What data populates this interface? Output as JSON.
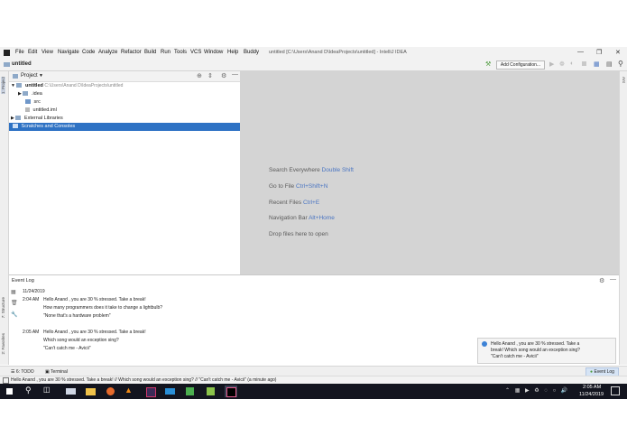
{
  "menu": {
    "items": [
      "File",
      "Edit",
      "View",
      "Navigate",
      "Code",
      "Analyze",
      "Refactor",
      "Build",
      "Run",
      "Tools",
      "VCS",
      "Window",
      "Help",
      "Buddy"
    ],
    "window_title": "untitled [C:\\Users\\Anand D\\IdeaProjects\\untitled] - IntelliJ IDEA"
  },
  "navbar": {
    "project_name": "untitled",
    "add_config_label": "Add Configuration..."
  },
  "project_panel": {
    "header": "Project",
    "tree": [
      {
        "label": "untitled",
        "path": "C:\\Users\\Anand D\\IdeaProjects\\untitled"
      },
      {
        "label": ".idea"
      },
      {
        "label": "src"
      },
      {
        "label": "untitled.iml"
      },
      {
        "label": "External Libraries"
      },
      {
        "label": "Scratches and Consoles"
      }
    ]
  },
  "side_tabs": {
    "left_project": "1: Project",
    "left_structure": "7: Structure",
    "left_favorites": "2: Favorites",
    "right_ant": "Ant"
  },
  "editor_hints": [
    {
      "text": "Search Everywhere",
      "key": "Double Shift"
    },
    {
      "text": "Go to File",
      "key": "Ctrl+Shift+N"
    },
    {
      "text": "Recent Files",
      "key": "Ctrl+E"
    },
    {
      "text": "Navigation Bar",
      "key": "Alt+Home"
    },
    {
      "text": "Drop files here to open",
      "key": ""
    }
  ],
  "event_log": {
    "title": "Event Log",
    "date": "11/24/2019",
    "entries": [
      {
        "time": "2:04 AM",
        "lines": [
          "Hello Anand , you are 30 % stressed. Take a break!",
          "How many programmers does it take to change a lightbulb?",
          "\"None that's a hardware problem\""
        ]
      },
      {
        "time": "2:05 AM",
        "lines": [
          "Hello Anand , you are 30 % stressed. Take a break!",
          "Which song would an exception sing?",
          "\"Can't catch me - Avicii\""
        ]
      }
    ],
    "balloon": [
      "Hello Anand , you are 30 % stressed. Take a",
      "break! Which song would an exception sing?",
      "\"Can't catch me - Avicii\""
    ]
  },
  "bottom_bar": {
    "todo": "6: TODO",
    "terminal": "Terminal",
    "event_log_btn": "Event Log"
  },
  "status_text": "Hello Anand , you are 30 % stressed. Take a break! // Which song would an exception sing? // \"Can't catch me - Avicii\" (a minute ago)",
  "taskbar": {
    "time": "2:05 AM",
    "date": "11/24/2019"
  }
}
